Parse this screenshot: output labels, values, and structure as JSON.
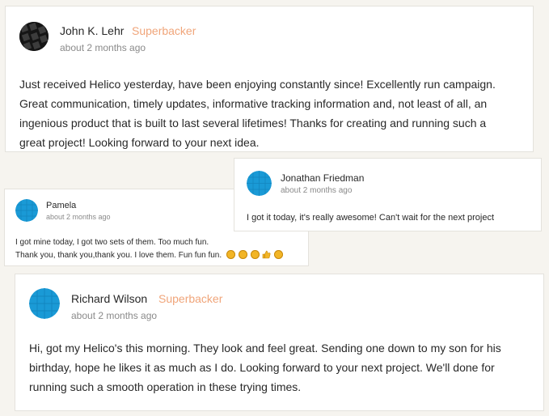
{
  "comments": [
    {
      "author": "John K. Lehr",
      "badge": "Superbacker",
      "time": "about 2 months ago",
      "lines": [
        "Just received Helico yesterday, have been enjoying constantly since! Excellently run campaign.",
        "Great communication, timely updates, informative tracking information and, not least of all, an",
        "ingenious product that is built to last several lifetimes! Thanks for creating and running such a",
        "great project! Looking forward to your next idea."
      ]
    },
    {
      "author": "Jonathan Friedman",
      "time": "about 2 months ago",
      "lines": [
        "I got it today, it's really awesome! Can't wait for the next project"
      ]
    },
    {
      "author": "Pamela",
      "time": "about 2 months ago",
      "lines": [
        "I got mine today, I got two sets of them. Too much fun.",
        "Thank you, thank you,thank you. I love them. Fun fun fun."
      ],
      "emojis": [
        "grinning-face-emoji",
        "grinning-face-emoji",
        "grinning-face-emoji",
        "thumbs-up-emoji",
        "grinning-face-emoji"
      ]
    },
    {
      "author": "Richard Wilson",
      "badge": "Superbacker",
      "time": "about 2 months ago",
      "lines": [
        "Hi, got my Helico's this morning. They look and feel great. Sending one down to my son for his",
        "birthday, hope he likes it as much as I do. Looking forward to your next project. We'll done for",
        "running such a smooth operation in these trying times."
      ]
    }
  ],
  "colors": {
    "background": "#f6f4ef",
    "badge": "#f0a57a",
    "avatar_blue": "#1a9ad6"
  }
}
